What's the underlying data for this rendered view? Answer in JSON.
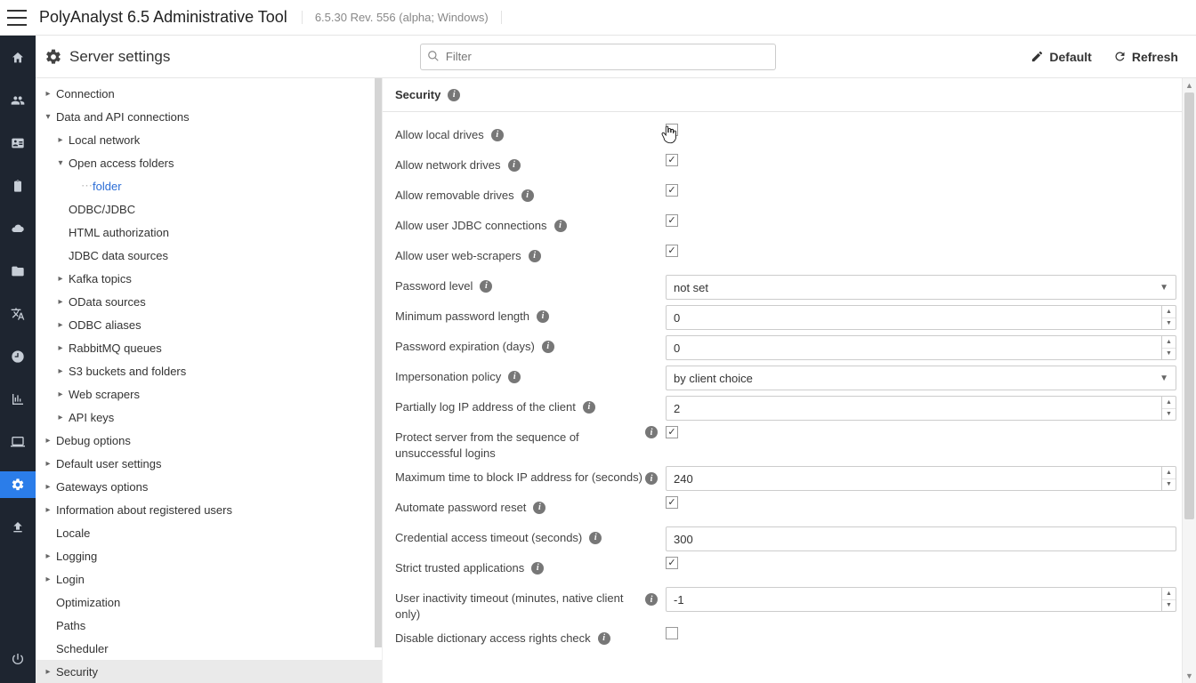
{
  "titlebar": {
    "app_name": "PolyAnalyst 6.5 Administrative Tool",
    "version": "6.5.30 Rev. 556 (alpha; Windows)"
  },
  "header": {
    "page_title": "Server settings",
    "filter_placeholder": "Filter",
    "default_label": "Default",
    "refresh_label": "Refresh"
  },
  "rail_icons": [
    {
      "name": "home-icon"
    },
    {
      "name": "users-icon"
    },
    {
      "name": "idcard-icon"
    },
    {
      "name": "clipboard-icon"
    },
    {
      "name": "cloud-icon"
    },
    {
      "name": "folder-icon"
    },
    {
      "name": "translate-icon"
    },
    {
      "name": "clock-icon"
    },
    {
      "name": "chart-icon"
    },
    {
      "name": "computer-icon"
    },
    {
      "name": "gears-icon",
      "active": true
    },
    {
      "name": "upload-icon"
    }
  ],
  "tree": [
    {
      "label": "Connection",
      "level": 0,
      "caret": "right"
    },
    {
      "label": "Data and API connections",
      "level": 0,
      "caret": "down"
    },
    {
      "label": "Local network",
      "level": 1,
      "caret": "right"
    },
    {
      "label": "Open access folders",
      "level": 1,
      "caret": "down"
    },
    {
      "label": "folder",
      "level": 2,
      "caret": "none",
      "link": true
    },
    {
      "label": "ODBC/JDBC",
      "level": 1,
      "caret": "none"
    },
    {
      "label": "HTML authorization",
      "level": 1,
      "caret": "none"
    },
    {
      "label": "JDBC data sources",
      "level": 1,
      "caret": "none"
    },
    {
      "label": "Kafka topics",
      "level": 1,
      "caret": "right"
    },
    {
      "label": "OData sources",
      "level": 1,
      "caret": "right"
    },
    {
      "label": "ODBC aliases",
      "level": 1,
      "caret": "right"
    },
    {
      "label": "RabbitMQ queues",
      "level": 1,
      "caret": "right"
    },
    {
      "label": "S3 buckets and folders",
      "level": 1,
      "caret": "right"
    },
    {
      "label": "Web scrapers",
      "level": 1,
      "caret": "right"
    },
    {
      "label": "API keys",
      "level": 1,
      "caret": "right"
    },
    {
      "label": "Debug options",
      "level": 0,
      "caret": "right"
    },
    {
      "label": "Default user settings",
      "level": 0,
      "caret": "right"
    },
    {
      "label": "Gateways options",
      "level": 0,
      "caret": "right"
    },
    {
      "label": "Information about registered users",
      "level": 0,
      "caret": "right"
    },
    {
      "label": "Locale",
      "level": 0,
      "caret": "none"
    },
    {
      "label": "Logging",
      "level": 0,
      "caret": "right"
    },
    {
      "label": "Login",
      "level": 0,
      "caret": "right"
    },
    {
      "label": "Optimization",
      "level": 0,
      "caret": "none"
    },
    {
      "label": "Paths",
      "level": 0,
      "caret": "none"
    },
    {
      "label": "Scheduler",
      "level": 0,
      "caret": "none"
    },
    {
      "label": "Security",
      "level": 0,
      "caret": "right",
      "active": true
    }
  ],
  "section": {
    "title": "Security"
  },
  "settings": [
    {
      "label": "Allow local drives",
      "type": "checkbox",
      "checked": false,
      "info": true
    },
    {
      "label": "Allow network drives",
      "type": "checkbox",
      "checked": true,
      "info": true
    },
    {
      "label": "Allow removable drives",
      "type": "checkbox",
      "checked": true,
      "info": true
    },
    {
      "label": "Allow user JDBC connections",
      "type": "checkbox",
      "checked": true,
      "info": true
    },
    {
      "label": "Allow user web-scrapers",
      "type": "checkbox",
      "checked": true,
      "info": true
    },
    {
      "label": "Password level",
      "type": "select",
      "value": "not set",
      "info": true
    },
    {
      "label": "Minimum password length",
      "type": "number",
      "value": "0",
      "info": true
    },
    {
      "label": "Password expiration (days)",
      "type": "number",
      "value": "0",
      "info": true
    },
    {
      "label": "Impersonation policy",
      "type": "select",
      "value": "by client choice",
      "info": true
    },
    {
      "label": "Partially log IP address of the client",
      "type": "number",
      "value": "2",
      "info": true
    },
    {
      "label": "Protect server from the sequence of unsuccessful logins",
      "type": "checkbox",
      "checked": true,
      "lead_info": true
    },
    {
      "label": "Maximum time to block IP address for (seconds)",
      "type": "number",
      "value": "240",
      "lead_info": true
    },
    {
      "label": "Automate password reset",
      "type": "checkbox",
      "checked": true,
      "info": true
    },
    {
      "label": "Credential access timeout (seconds)",
      "type": "number",
      "value": "300",
      "info": true,
      "nospin": true
    },
    {
      "label": "Strict trusted applications",
      "type": "checkbox",
      "checked": true,
      "info": true
    },
    {
      "label": "User inactivity timeout (minutes, native client only)",
      "type": "number",
      "value": "-1",
      "lead_info": true
    },
    {
      "label": "Disable dictionary access rights check",
      "type": "checkbox",
      "checked": false,
      "info": true
    }
  ]
}
